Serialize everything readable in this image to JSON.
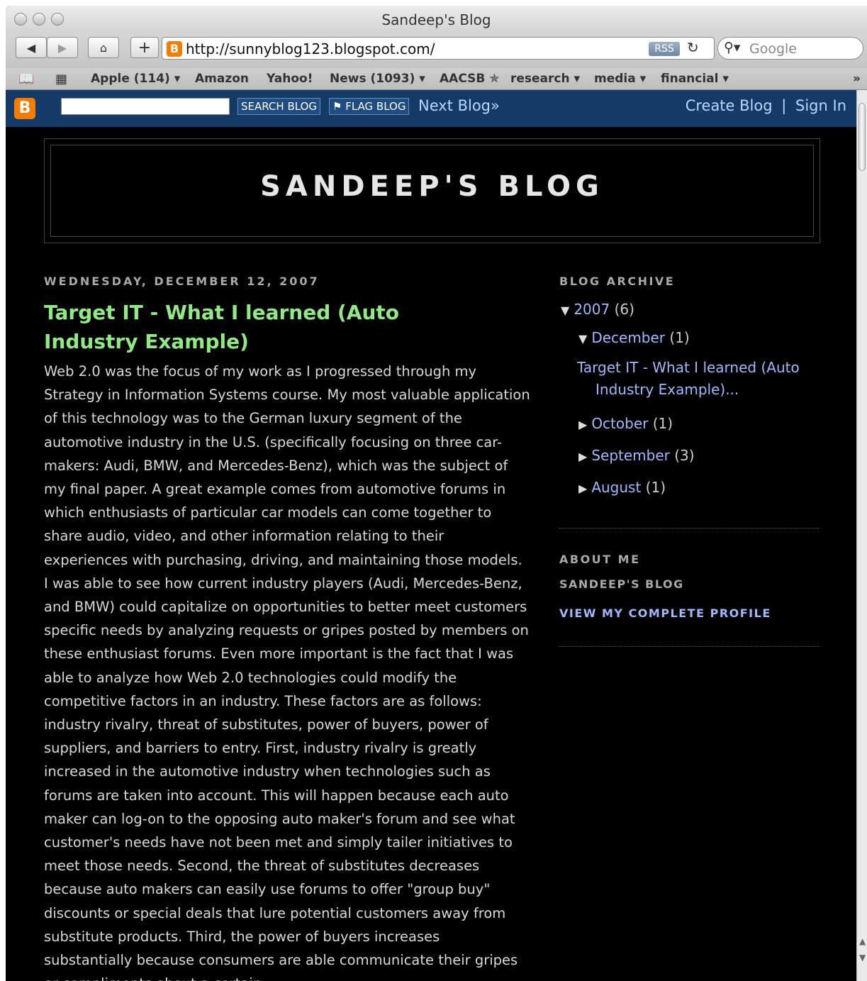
{
  "window": {
    "title": "Sandeep's Blog"
  },
  "toolbar": {
    "back_icon": "back-arrow-icon",
    "forward_icon": "forward-arrow-icon",
    "home_icon": "home-icon",
    "add_icon": "plus-icon",
    "url": "http://sunnyblog123.blogspot.com/",
    "rss_label": "RSS",
    "reload_icon": "reload-icon",
    "search_placeholder": "Google"
  },
  "bookmarks": [
    "Apple (114) ▾",
    "Amazon",
    "Yahoo!",
    "News (1093) ▾",
    "AACSB ✯",
    "research ▾",
    "media ▾",
    "financial ▾"
  ],
  "bookmarks_overflow": "»",
  "navbar": {
    "search_button": "SEARCH BLOG",
    "flag_button": "FLAG BLOG",
    "next_blog": "Next Blog»",
    "create_blog": "Create Blog",
    "separator": "|",
    "sign_in": "Sign In"
  },
  "header": {
    "blog_title": "SANDEEP'S BLOG"
  },
  "post": {
    "date": "WEDNESDAY, DECEMBER 12, 2007",
    "title": "Target IT - What I learned (Auto Industry Example)",
    "body": "Web 2.0 was the focus of my work as I progressed through my Strategy in Information Systems course. My most valuable application of this technology was to the German luxury segment of the automotive industry in the U.S. (specifically focusing on three car-makers: Audi, BMW, and Mercedes-Benz), which was the subject of my final paper. A great example comes from automotive forums in which enthusiasts of particular car models can come together to share audio, video, and other information relating to their experiences with purchasing, driving, and maintaining those models. I was able to see how current industry players (Audi, Mercedes-Benz, and BMW) could capitalize on opportunities to better meet customers specific needs by analyzing requests or gripes posted by members on these enthusiast forums. Even more important is the fact that I was able to analyze how Web 2.0 technologies could modify the competitive factors in an industry. These factors are as follows: industry rivalry, threat of substitutes, power of buyers, power of suppliers, and barriers to entry. First, industry rivalry is greatly increased in the automotive industry when technologies such as forums are taken into account. This will happen because each auto maker can log-on to the opposing auto maker's forum and see what customer's needs have not been met and simply tailer initiatives to meet those needs. Second, the threat of substitutes decreases because auto makers can easily use forums to offer \"group buy\" discounts or special deals that lure potential customers away from substitute products. Third, the power of buyers increases substantially because consumers are able communicate their gripes or compliments about a certain"
  },
  "sidebar": {
    "archive_heading": "BLOG ARCHIVE",
    "year": {
      "label": "2007",
      "count": "(6)"
    },
    "december": {
      "label": "December",
      "count": "(1)"
    },
    "december_post": "Target IT - What I learned (Auto Industry Example)...",
    "october": {
      "label": "October",
      "count": "(1)"
    },
    "september": {
      "label": "September",
      "count": "(3)"
    },
    "august": {
      "label": "August",
      "count": "(1)"
    },
    "about_heading": "ABOUT ME",
    "about_name": "SANDEEP'S BLOG",
    "profile_link": "VIEW MY COMPLETE PROFILE"
  },
  "colors": {
    "navbar": "#143a68",
    "post_title": "#90ea84",
    "link": "#9fb8ff",
    "background": "#000000"
  }
}
